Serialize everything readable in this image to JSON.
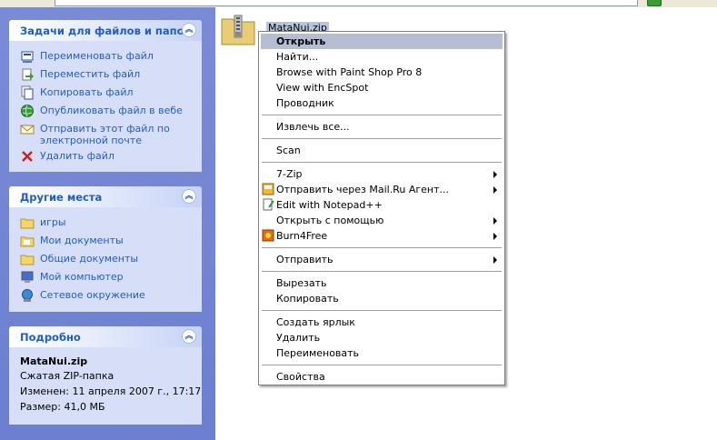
{
  "tasks_panel": {
    "title": "Задачи для файлов и папок",
    "items": [
      {
        "label": "Переименовать файл",
        "icon": "rename-icon"
      },
      {
        "label": "Переместить файл",
        "icon": "move-icon"
      },
      {
        "label": "Копировать файл",
        "icon": "copy-icon"
      },
      {
        "label": "Опубликовать файл в вебе",
        "icon": "globe-icon"
      },
      {
        "label": "Отправить этот файл по электронной почте",
        "icon": "mail-icon"
      },
      {
        "label": "Удалить файл",
        "icon": "delete-icon"
      }
    ]
  },
  "places_panel": {
    "title": "Другие места",
    "items": [
      {
        "label": "игры",
        "icon": "folder-icon"
      },
      {
        "label": "Мои документы",
        "icon": "folder-icon"
      },
      {
        "label": "Общие документы",
        "icon": "folder-icon"
      },
      {
        "label": "Мой компьютер",
        "icon": "computer-icon"
      },
      {
        "label": "Сетевое окружение",
        "icon": "network-icon"
      }
    ]
  },
  "details_panel": {
    "title": "Подробно",
    "name": "MataNui.zip",
    "type": "Сжатая ZIP-папка",
    "modified": "Изменен: 11 апреля 2007 г., 17:17",
    "size": "Размер: 41,0 МБ"
  },
  "file": {
    "name": "MataNui.zip"
  },
  "context_menu": {
    "open": "Открыть",
    "find": "Найти...",
    "paintshop": "Browse with Paint Shop Pro 8",
    "encspot": "View with EncSpot",
    "explorer": "Проводник",
    "extract": "Извлечь все...",
    "scan": "Scan",
    "sevenzip": "7-Zip",
    "mailru": "Отправить через Mail.Ru Агент...",
    "notepad": "Edit with Notepad++",
    "openwith": "Открыть с помощью",
    "burn": "Burn4Free",
    "sendto": "Отправить",
    "cut": "Вырезать",
    "copy": "Копировать",
    "shortcut": "Создать ярлык",
    "delete": "Удалить",
    "rename": "Переименовать",
    "properties": "Свойства"
  },
  "colors": {
    "pane_bg": "#6c7fd0",
    "panel_bg": "#d6dff7",
    "link": "#215dc6",
    "menu_highlight": "#b6bdd2"
  }
}
